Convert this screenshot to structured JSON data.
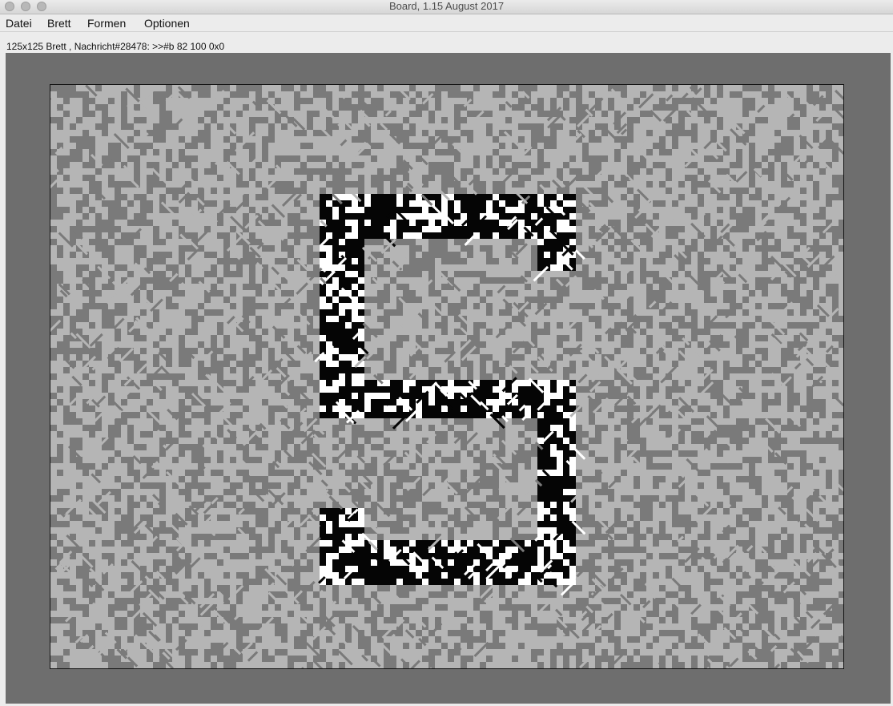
{
  "window": {
    "title": "Board, 1.15 August 2017"
  },
  "menu": {
    "items": [
      "Datei",
      "Brett",
      "Formen",
      "Optionen"
    ]
  },
  "status": {
    "text": "125x125 Brett , Nachricht#28478: >>#b 82 100 0x0"
  },
  "board": {
    "grid_cells": 125,
    "colors": {
      "background": "#6e6e6e",
      "noise_light": "#b5b5b5",
      "noise_dark": "#7a7a7a",
      "shape_dark": "#050505",
      "shape_light": "#ffffff"
    }
  }
}
